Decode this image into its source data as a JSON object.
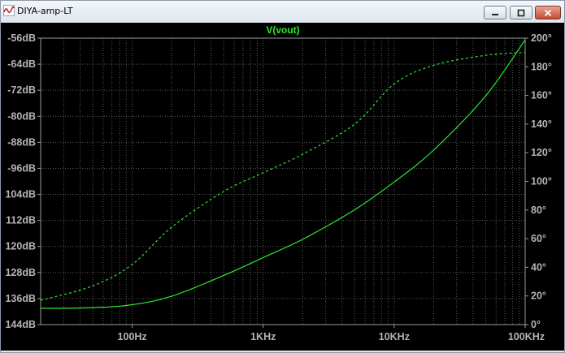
{
  "window": {
    "title": "DIYA-amp-LT",
    "minimize_icon": "minimize-icon",
    "restore_icon": "restore-icon",
    "close_icon": "close-icon",
    "app_icon": "ltspice-wave-icon"
  },
  "chart_data": {
    "type": "line",
    "title": "V(vout)",
    "x_scale": "log",
    "xlim": [
      20,
      100000
    ],
    "x_ticks": [
      {
        "value": 100,
        "label": "100Hz"
      },
      {
        "value": 1000,
        "label": "1KHz"
      },
      {
        "value": 10000,
        "label": "10KHz"
      },
      {
        "value": 100000,
        "label": "100KHz"
      }
    ],
    "y_left": {
      "unit": "dB",
      "ylim": [
        -144,
        -56
      ],
      "ticks": [
        "-56dB",
        "-64dB",
        "-72dB",
        "-80dB",
        "-88dB",
        "-96dB",
        "104dB",
        "112dB",
        "120dB",
        "128dB",
        "136dB",
        "144dB"
      ],
      "tick_values": [
        -56,
        -64,
        -72,
        -80,
        -88,
        -96,
        -104,
        -112,
        -120,
        -128,
        -136,
        -144
      ]
    },
    "y_right": {
      "unit": "°",
      "ylim": [
        0,
        200
      ],
      "ticks": [
        "200°",
        "180°",
        "160°",
        "140°",
        "120°",
        "100°",
        "80°",
        "60°",
        "40°",
        "20°",
        "0°"
      ],
      "tick_values": [
        200,
        180,
        160,
        140,
        120,
        100,
        80,
        60,
        40,
        20,
        0
      ]
    },
    "grid": true,
    "series": [
      {
        "role": "magnitude",
        "axis": "left",
        "style": "solid",
        "color": "#2ee82e",
        "x": [
          20,
          50,
          100,
          200,
          500,
          1000,
          2000,
          5000,
          10000,
          20000,
          50000,
          100000
        ],
        "y": [
          -139,
          -138.8,
          -137.9,
          -135.3,
          -128.9,
          -123.4,
          -117.8,
          -108.7,
          -100.2,
          -90.4,
          -73.7,
          -56.5
        ]
      },
      {
        "role": "phase",
        "axis": "right",
        "style": "dashed",
        "color": "#2ee82e",
        "x": [
          20,
          50,
          100,
          200,
          500,
          1000,
          2000,
          5000,
          10000,
          20000,
          50000,
          100000
        ],
        "y": [
          17,
          27,
          42,
          68,
          93,
          106,
          119,
          140,
          168,
          181,
          188,
          190
        ]
      }
    ]
  }
}
